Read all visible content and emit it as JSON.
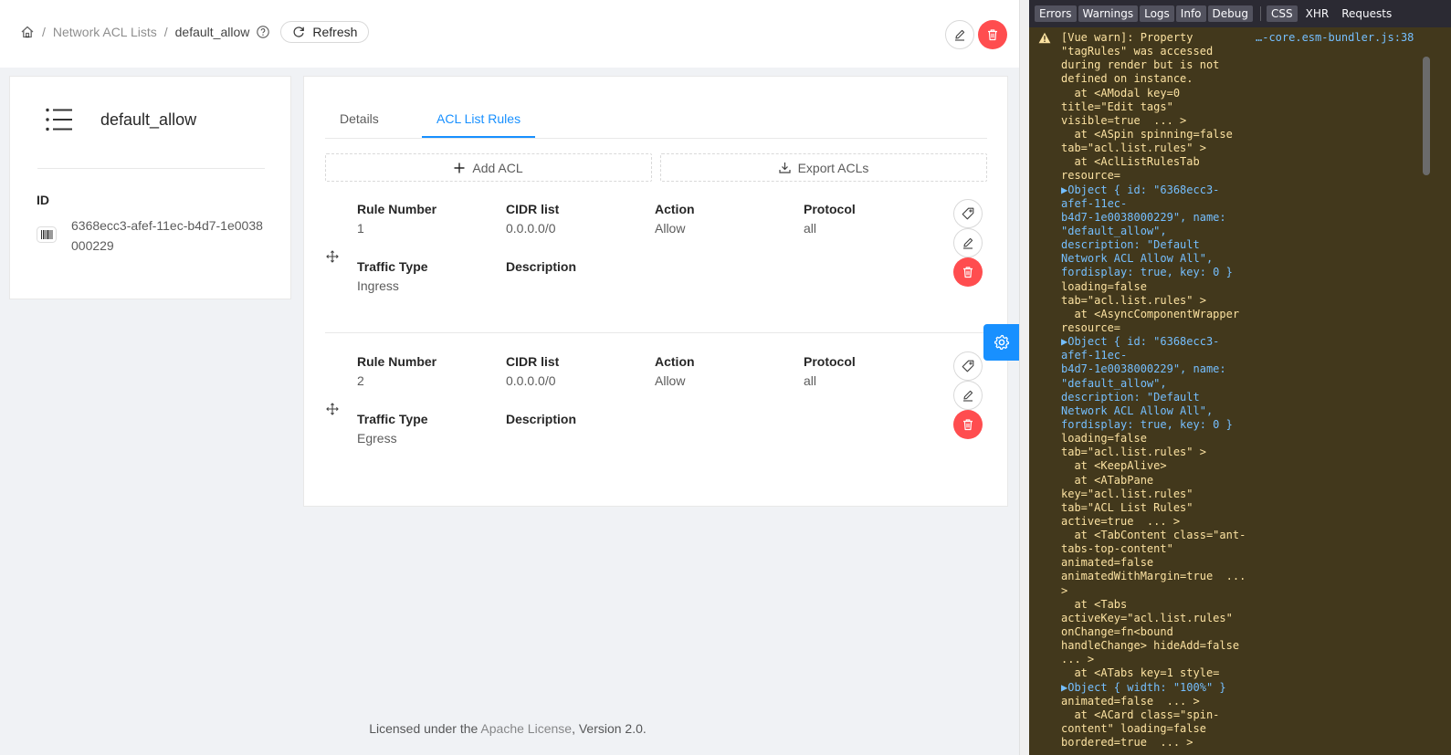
{
  "breadcrumb": {
    "home_icon": "home-icon",
    "sep": "/",
    "parent": "Network ACL Lists",
    "current": "default_allow",
    "help_icon": "question-circle-icon"
  },
  "header": {
    "refresh_label": "Refresh",
    "edit_icon": "edit-icon",
    "delete_icon": "delete-icon",
    "delete_color": "#ff4d4f"
  },
  "info": {
    "name": "default_allow",
    "id_label": "ID",
    "id_value": "6368ecc3-afef-11ec-b4d7-1e0038000229"
  },
  "tabs": [
    {
      "label": "Details",
      "active": false
    },
    {
      "label": "ACL List Rules",
      "active": true
    }
  ],
  "actions": {
    "add_label": "Add ACL",
    "export_label": "Export ACLs"
  },
  "labels": {
    "rule_number": "Rule Number",
    "cidr_list": "CIDR list",
    "action": "Action",
    "protocol": "Protocol",
    "traffic_type": "Traffic Type",
    "description": "Description"
  },
  "rules": [
    {
      "rule_number": "1",
      "cidr_list": "0.0.0.0/0",
      "action": "Allow",
      "protocol": "all",
      "traffic_type": "Ingress",
      "description": ""
    },
    {
      "rule_number": "2",
      "cidr_list": "0.0.0.0/0",
      "action": "Allow",
      "protocol": "all",
      "traffic_type": "Egress",
      "description": ""
    }
  ],
  "footer": {
    "prefix": "Licensed under the ",
    "link": "Apache License",
    "suffix": ", Version 2.0."
  },
  "colors": {
    "primary": "#1890ff",
    "danger": "#ff4d4f",
    "console_bg": "#42381c",
    "console_text": "#fce2a1"
  },
  "devtools": {
    "filters": [
      "Errors",
      "Warnings",
      "Logs",
      "Info",
      "Debug"
    ],
    "tabs": [
      "CSS",
      "XHR",
      "Requests"
    ],
    "source": "…-core.esm-bundler.js:38",
    "message_lines": [
      "[Vue warn]: Property",
      "\"tagRules\" was accessed",
      "during render but is not",
      "defined on instance.",
      "  at <AModal key=0",
      "title=\"Edit tags\"",
      "visible=true  ... >",
      "  at <ASpin spinning=false",
      "tab=\"acl.list.rules\" >",
      "  at <AclListRulesTab",
      "resource=",
      "▶Object { id: \"6368ecc3-",
      "afef-11ec-",
      "b4d7-1e0038000229\", name:",
      "\"default_allow\",",
      "description: \"Default",
      "Network ACL Allow All\",",
      "fordisplay: true, key: 0 }",
      "loading=false",
      "tab=\"acl.list.rules\" >",
      "  at <AsyncComponentWrapper",
      "resource=",
      "▶Object { id: \"6368ecc3-",
      "afef-11ec-",
      "b4d7-1e0038000229\", name:",
      "\"default_allow\",",
      "description: \"Default",
      "Network ACL Allow All\",",
      "fordisplay: true, key: 0 }",
      "loading=false",
      "tab=\"acl.list.rules\" >",
      "  at <KeepAlive>",
      "  at <ATabPane",
      "key=\"acl.list.rules\"",
      "tab=\"ACL List Rules\"",
      "active=true  ... >",
      "  at <TabContent class=\"ant-",
      "tabs-top-content\"",
      "animated=false",
      "animatedWithMargin=true  ...",
      ">",
      "  at <Tabs",
      "activeKey=\"acl.list.rules\"",
      "onChange=fn<bound",
      "handleChange> hideAdd=false",
      "... >",
      "  at <ATabs key=1 style=",
      "▶Object { width: \"100%\" }",
      "animated=false  ... >",
      "  at <ACard class=\"spin-",
      "content\" loading=false",
      "bordered=true  ... >"
    ]
  }
}
